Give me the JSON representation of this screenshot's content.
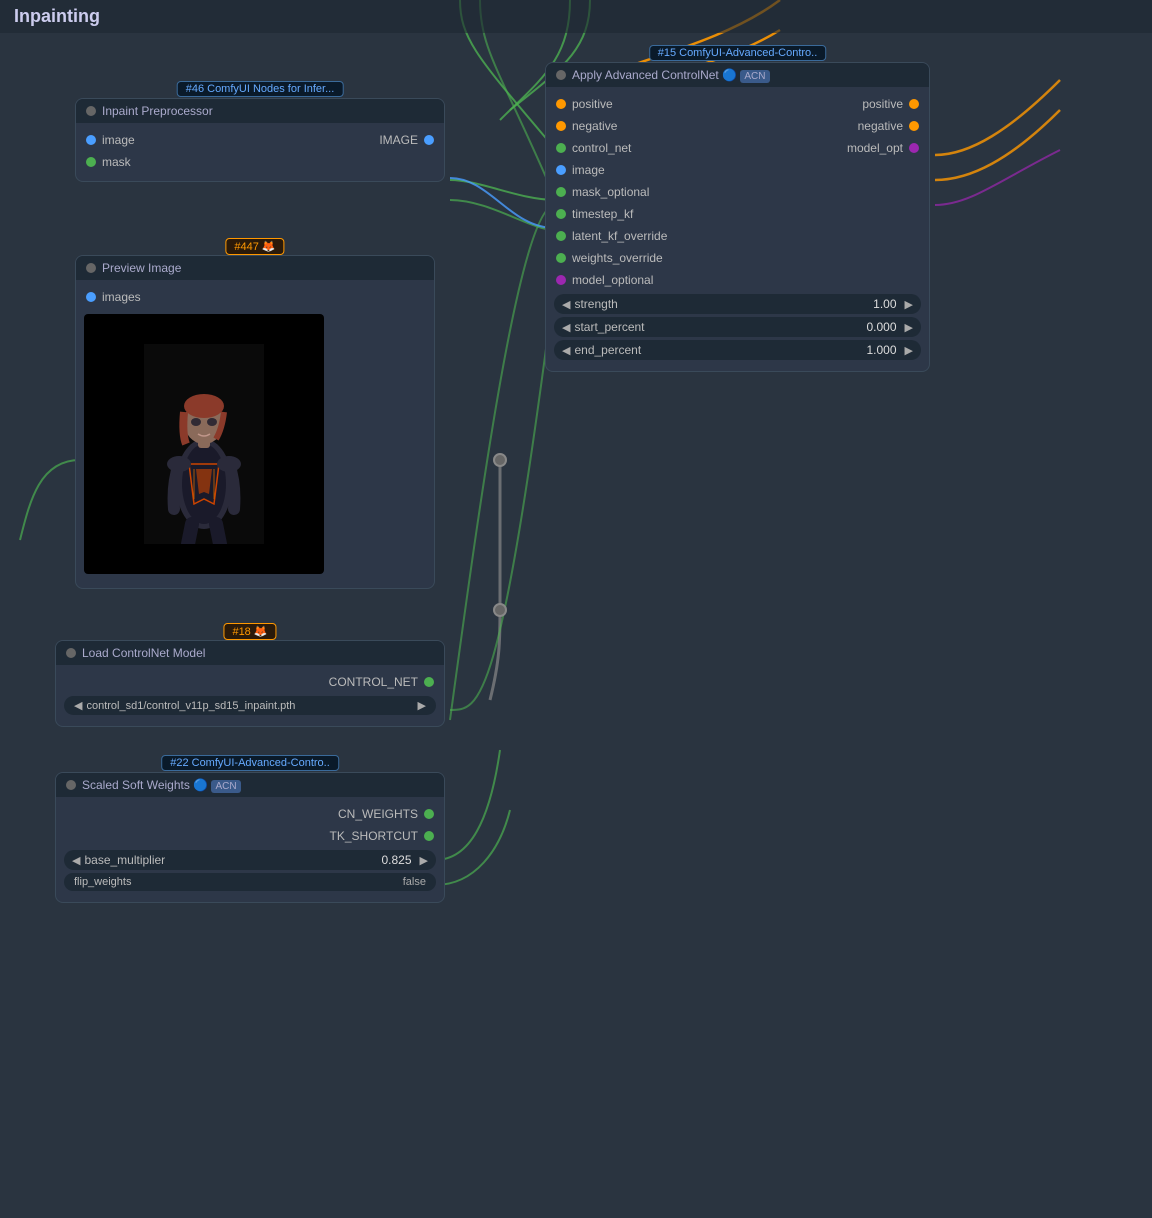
{
  "title": "Inpainting",
  "nodes": {
    "inpaint_preprocessor": {
      "title": "Inpaint Preprocessor",
      "badge": "#46 ComfyUI Nodes for Infer...",
      "ports_left": [
        {
          "label": "image",
          "color": "blue"
        },
        {
          "label": "mask",
          "color": "green"
        }
      ],
      "ports_right": [
        {
          "label": "IMAGE",
          "color": "blue"
        }
      ]
    },
    "preview_image": {
      "title": "Preview Image",
      "badge": "#447 🦊",
      "port_left": {
        "label": "images",
        "color": "blue"
      }
    },
    "apply_advanced_controlnet": {
      "title": "Apply Advanced ControlNet 🔵 ACN",
      "badge": "#15 ComfyUI-Advanced-Contro..",
      "ports_left": [
        {
          "label": "positive",
          "color": "orange"
        },
        {
          "label": "negative",
          "color": "orange"
        },
        {
          "label": "control_net",
          "color": "green"
        },
        {
          "label": "image",
          "color": "blue"
        },
        {
          "label": "mask_optional",
          "color": "green"
        },
        {
          "label": "timestep_kf",
          "color": "green"
        },
        {
          "label": "latent_kf_override",
          "color": "green"
        },
        {
          "label": "weights_override",
          "color": "green"
        },
        {
          "label": "model_optional",
          "color": "purple"
        }
      ],
      "ports_right": [
        {
          "label": "positive",
          "color": "orange"
        },
        {
          "label": "negative",
          "color": "orange"
        },
        {
          "label": "model_opt",
          "color": "purple"
        }
      ],
      "sliders": [
        {
          "label": "strength",
          "value": "1.00"
        },
        {
          "label": "start_percent",
          "value": "0.000"
        },
        {
          "label": "end_percent",
          "value": "1.000"
        }
      ]
    },
    "load_controlnet": {
      "title": "Load ControlNet Model",
      "badge": "#18 🦊",
      "port_right": {
        "label": "CONTROL_NET",
        "color": "green"
      },
      "dropdown": "control_sd1/control_v11p_sd15_inpaint.pth"
    },
    "scaled_soft_weights": {
      "title": "Scaled Soft Weights 🔵 ACN",
      "badge": "#22 ComfyUI-Advanced-Contro..",
      "ports_right": [
        {
          "label": "CN_WEIGHTS",
          "color": "green"
        },
        {
          "label": "TK_SHORTCUT",
          "color": "green"
        }
      ],
      "sliders": [
        {
          "label": "base_multiplier",
          "value": "0.825"
        }
      ],
      "dropdowns": [
        {
          "label": "flip_weights",
          "value": "false"
        }
      ]
    }
  }
}
